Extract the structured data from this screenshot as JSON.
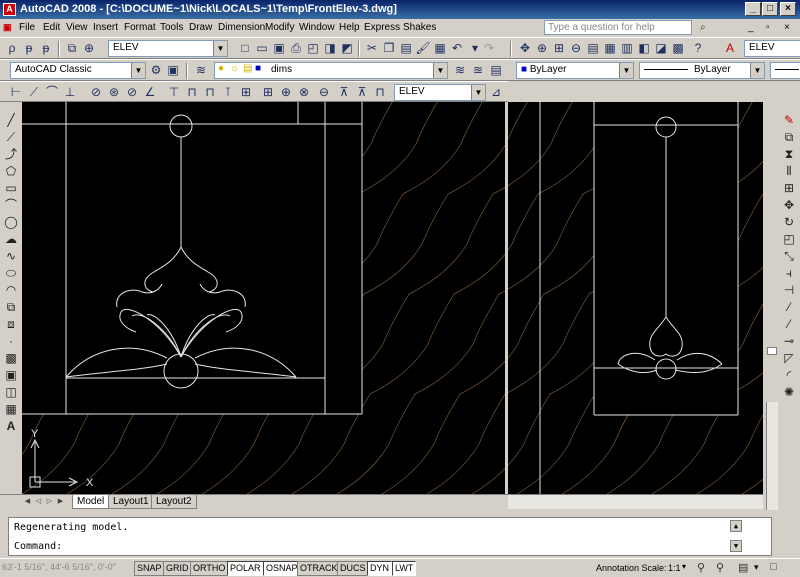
{
  "window": {
    "title": "AutoCAD 2008 - [C:\\DOCUME~1\\Nick\\LOCALS~1\\Temp\\FrontElev-3.dwg]",
    "app_icon": "A"
  },
  "menu": {
    "items": [
      "File",
      "Edit",
      "View",
      "Insert",
      "Format",
      "Tools",
      "Draw",
      "Dimension",
      "Modify",
      "Window",
      "Help",
      "Express",
      "Shakes"
    ],
    "help_placeholder": "Type a question for help"
  },
  "toolbar1": {
    "named_view": "ELEV",
    "right_combo": "ELEV"
  },
  "toolbar2": {
    "workspace": "AutoCAD Classic",
    "layer": "dims",
    "color": "ByLayer",
    "linetype": "ByLayer"
  },
  "toolbar3": {
    "dimstyle": "ELEV"
  },
  "ucs": {
    "x": "X",
    "y": "Y"
  },
  "tabs": [
    "Model",
    "Layout1",
    "Layout2"
  ],
  "command": {
    "history": "Regenerating model.",
    "prompt": "Command:"
  },
  "status": {
    "coords": "63'-1 5/16\", 44'-6 5/16\", 0'-0\"",
    "toggles": [
      "SNAP",
      "GRID",
      "ORTHO",
      "POLAR",
      "OSNAP",
      "OTRACK",
      "DUCS",
      "DYN",
      "LWT"
    ],
    "on": [
      "POLAR",
      "OSNAP",
      "DYN",
      "LWT"
    ],
    "annotation_label": "Annotation Scale:",
    "annotation_value": "1:1"
  },
  "colors": {
    "title_start": "#0a246a",
    "canvas": "#000000",
    "geometry": "#ffffff",
    "hatch": "#7a5a3a",
    "color_swatch": "#0000cc"
  }
}
